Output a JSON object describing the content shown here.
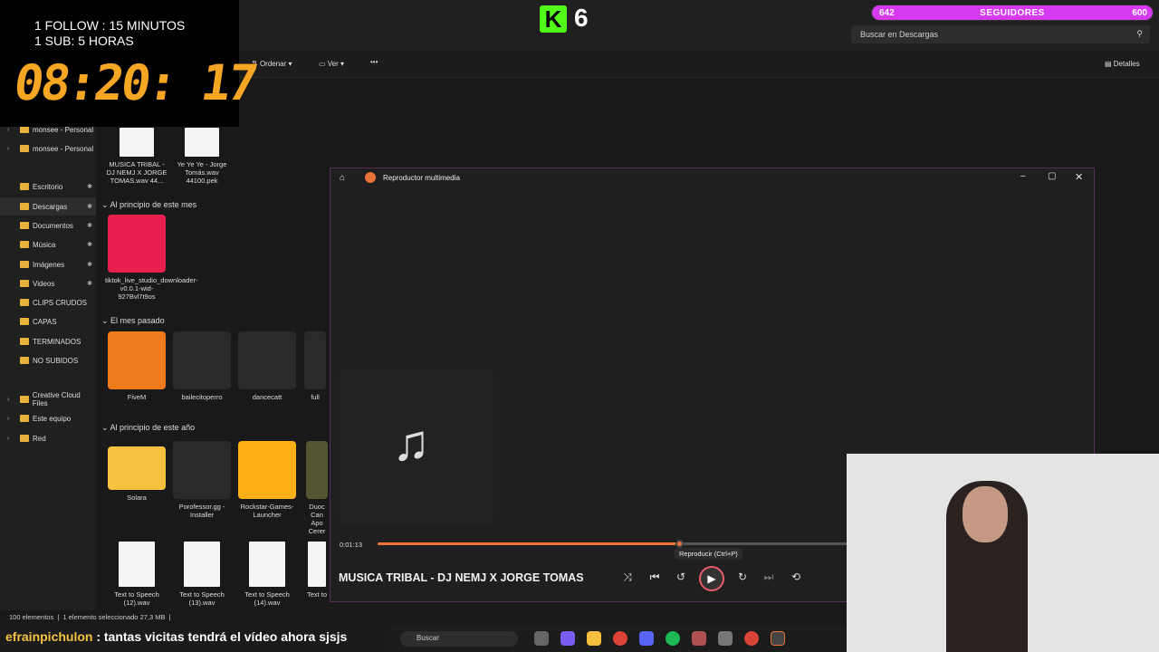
{
  "overlay": {
    "line1": "1 FOLLOW : 15 MINUTOS",
    "line2": "1 SUB: 5 HORAS",
    "timer": "08:20: 17"
  },
  "kick": {
    "logo": "K",
    "count": "6"
  },
  "followers": {
    "current": "642",
    "label": "SEGUIDORES",
    "goal": "600",
    "fill": 1.0
  },
  "explorer": {
    "search_placeholder": "Buscar en Descargas",
    "toolbar": {
      "sort": "Ordenar",
      "view": "Ver",
      "more": "•••",
      "details": "Detalles"
    },
    "sidebar": [
      {
        "label": "monsee - Personal",
        "pin": false,
        "chevron": true
      },
      {
        "label": "monsee - Personal",
        "pin": false,
        "chevron": true
      },
      {
        "label": "Escritorio",
        "pin": true
      },
      {
        "label": "Descargas",
        "pin": true,
        "selected": true
      },
      {
        "label": "Documentos",
        "pin": true
      },
      {
        "label": "Música",
        "pin": true
      },
      {
        "label": "Imágenes",
        "pin": true
      },
      {
        "label": "Videos",
        "pin": true
      },
      {
        "label": "CLIPS CRUDOS"
      },
      {
        "label": "CAPAS"
      },
      {
        "label": "TERMINADOS"
      },
      {
        "label": "NO SUBIDOS"
      },
      {
        "label": "Creative Cloud Files",
        "chevron": true
      },
      {
        "label": "Este equipo",
        "chevron": true
      },
      {
        "label": "Red",
        "chevron": true
      }
    ],
    "sections": {
      "s1": "Al principio de este mes",
      "s2": "El mes pasado",
      "s3": "Al principio de este año"
    },
    "files_top": [
      "MUSICA TRIBAL - DJ NEMJ X JORGE TOMAS.wav 44...",
      "Ye Ye Ye - Jorge Tomás.wav 44100.pek"
    ],
    "file_tiktok": "tiktok_live_studio_downloader-v0.0.1-wid-927Bvl7t9os",
    "files_month": [
      "FiveM",
      "bailecitoperro",
      "dancecatt",
      "full"
    ],
    "files_year": [
      "Solara",
      "Porofessor.gg - Installer",
      "Rockstar-Games-Launcher",
      "Duoc Can Apo Cerer"
    ],
    "files_bottom": [
      "Text to Speech (12).wav",
      "Text to Speech (13).wav",
      "Text to Speech (14).wav",
      "Text to"
    ],
    "status": {
      "items": "100 elementos",
      "selected": "1 elemento seleccionado",
      "size": "27,3 MB"
    }
  },
  "player": {
    "title": "Reproductor multimedia",
    "elapsed": "0:01:13",
    "progress": 0.64,
    "tooltip": "Reproducir (Ctrl+P)",
    "song": "MUSICA TRIBAL - DJ NEMJ X JORGE TOMAS"
  },
  "chat": {
    "user": "efrainpichulon",
    "message": " : tantas vicitas tendrá el vídeo ahora sjsjs"
  },
  "taskbar": {
    "search": "Buscar"
  }
}
